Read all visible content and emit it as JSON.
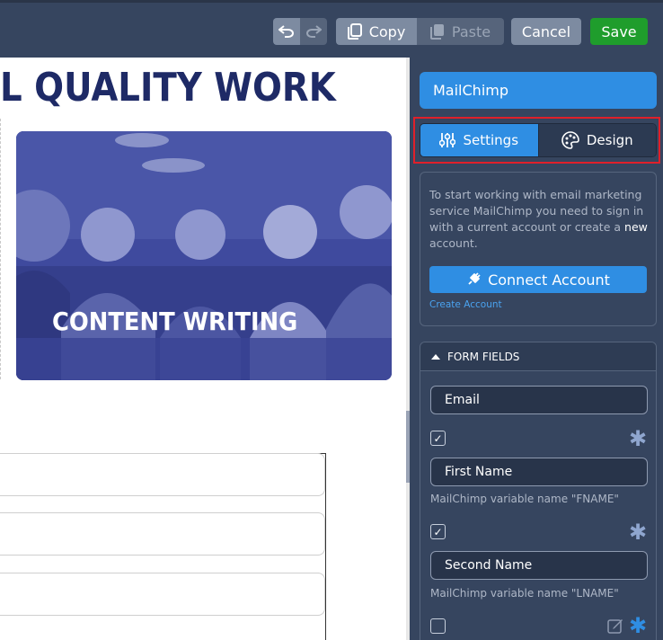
{
  "toolbar": {
    "copy_label": "Copy",
    "paste_label": "Paste",
    "cancel_label": "Cancel",
    "save_label": "Save",
    "save_color": "#1f9d2c"
  },
  "canvas": {
    "headline": "L QUALITY WORK",
    "card_title": "CONTENT WRITING"
  },
  "panel": {
    "title": "MailChimp",
    "tabs": [
      {
        "label": "Settings",
        "icon": "sliders-icon",
        "active": true
      },
      {
        "label": "Design",
        "icon": "palette-icon",
        "active": false
      }
    ],
    "info_text": "To start working with email marketing service MailChimp you need to sign in with a current account or create a",
    "info_text_highlight": "new",
    "info_text_end": "account.",
    "connect_label": "Connect Account",
    "create_link": "Create Account",
    "form_fields_header": "FORM FIELDS",
    "fields": [
      {
        "label": "Email",
        "checked": true,
        "required_star": true,
        "var_note": ""
      },
      {
        "label": "First Name",
        "checked": true,
        "required_star": true,
        "var_note": "MailChimp variable name \"FNAME\""
      },
      {
        "label": "Second Name",
        "checked": false,
        "required_star": true,
        "var_note": "MailChimp variable name \"LNAME\""
      }
    ],
    "accent_color": "#2f8ee3"
  }
}
